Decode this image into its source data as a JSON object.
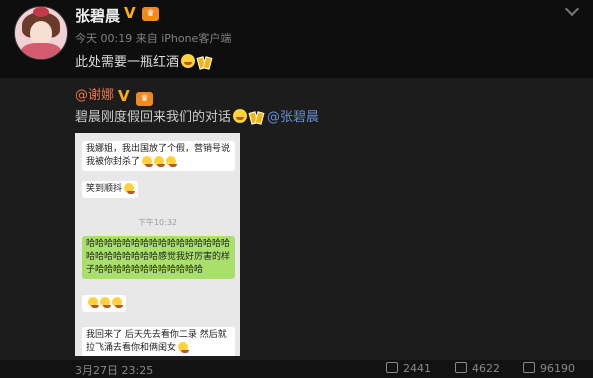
{
  "post": {
    "username": "张碧晨",
    "verified_mark": "V",
    "meta": "今天 00:19 来自 iPhone客户端",
    "text": "此处需要一瓶红酒"
  },
  "repost": {
    "username": "@谢娜",
    "verified_mark": "V",
    "text": "碧晨刚度假回来我们的对话",
    "mention": "@张碧晨",
    "chat": {
      "msg1": "我娜姐，我出国放了个假，营销号说我被你封杀了",
      "msg2": "笑到顺抖",
      "time": "下午10:32",
      "msg3": "哈哈哈哈哈哈哈哈哈哈哈哈哈哈哈哈哈哈哈哈哈哈哈哈感觉我好厉害的样子哈哈哈哈哈哈哈哈哈哈哈哈",
      "msg4": "",
      "msg5": "我回来了 后天先去看你二录 然后就拉飞涌去看你和俩闺女"
    }
  },
  "footer": {
    "date": "3月27日 23:25",
    "reposts": "2441",
    "comments": "4622",
    "likes": "96190"
  },
  "colors": {
    "accent_orange": "#eb7350",
    "mention_blue": "#6a8ed6",
    "wechat_green": "#a8e06a"
  }
}
